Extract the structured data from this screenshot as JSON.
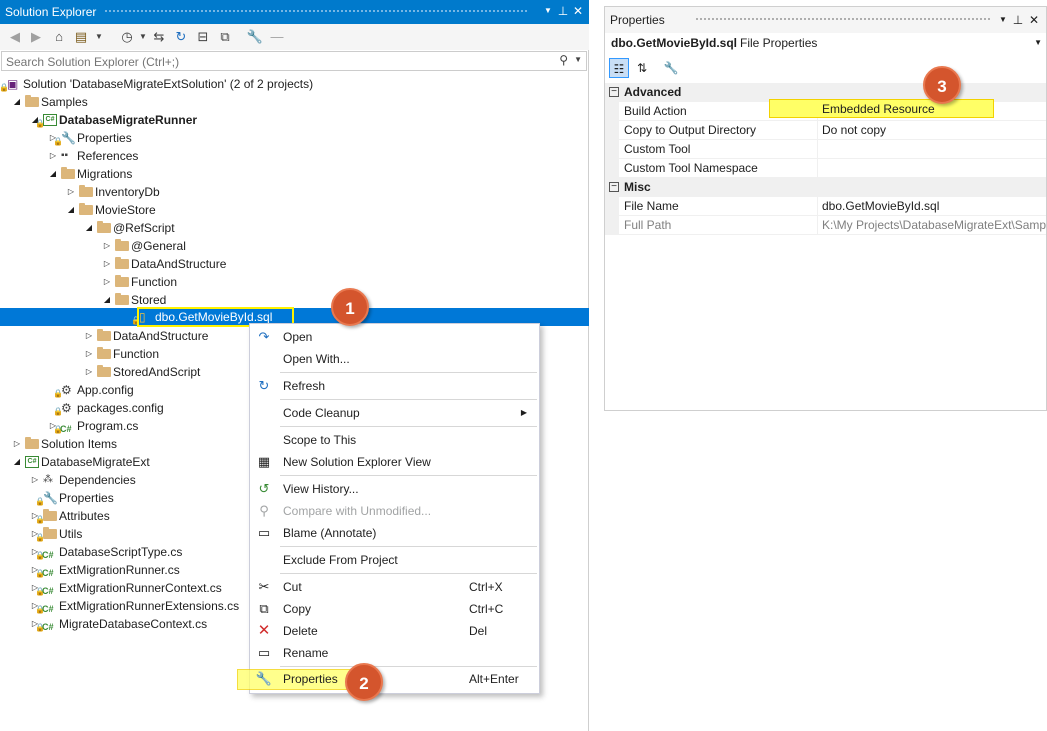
{
  "solution_explorer": {
    "title": "Solution Explorer",
    "search_placeholder": "Search Solution Explorer (Ctrl+;)",
    "tree": [
      {
        "label": "Solution 'DatabaseMigrateExtSolution' (2 of 2 projects)",
        "icon": "solution-icon"
      },
      {
        "label": "Samples",
        "icon": "folder-icon"
      },
      {
        "label": "DatabaseMigrateRunner",
        "icon": "csharp-project-icon"
      },
      {
        "label": "Properties",
        "icon": "wrench-icon"
      },
      {
        "label": "References",
        "icon": "references-icon"
      },
      {
        "label": "Migrations",
        "icon": "folder-icon"
      },
      {
        "label": "InventoryDb",
        "icon": "folder-icon"
      },
      {
        "label": "MovieStore",
        "icon": "folder-icon"
      },
      {
        "label": "@RefScript",
        "icon": "folder-icon"
      },
      {
        "label": "@General",
        "icon": "folder-icon"
      },
      {
        "label": "DataAndStructure",
        "icon": "folder-icon"
      },
      {
        "label": "Function",
        "icon": "folder-icon"
      },
      {
        "label": "Stored",
        "icon": "folder-icon"
      },
      {
        "label": "dbo.GetMovieById.sql",
        "icon": "sql-file-icon"
      },
      {
        "label": "DataAndStructure",
        "icon": "folder-icon"
      },
      {
        "label": "Function",
        "icon": "folder-icon"
      },
      {
        "label": "StoredAndScript",
        "icon": "folder-icon"
      },
      {
        "label": "App.config",
        "icon": "config-icon"
      },
      {
        "label": "packages.config",
        "icon": "config-icon"
      },
      {
        "label": "Program.cs",
        "icon": "csharp-file-icon"
      },
      {
        "label": "Solution Items",
        "icon": "folder-icon"
      },
      {
        "label": "DatabaseMigrateExt",
        "icon": "csharp-project-icon"
      },
      {
        "label": "Dependencies",
        "icon": "dependencies-icon"
      },
      {
        "label": "Properties",
        "icon": "wrench-icon"
      },
      {
        "label": "Attributes",
        "icon": "folder-icon"
      },
      {
        "label": "Utils",
        "icon": "folder-icon"
      },
      {
        "label": "DatabaseScriptType.cs",
        "icon": "csharp-file-icon"
      },
      {
        "label": "ExtMigrationRunner.cs",
        "icon": "csharp-file-icon"
      },
      {
        "label": "ExtMigrationRunnerContext.cs",
        "icon": "csharp-file-icon"
      },
      {
        "label": "ExtMigrationRunnerExtensions.cs",
        "icon": "csharp-file-icon"
      },
      {
        "label": "MigrateDatabaseContext.cs",
        "icon": "csharp-file-icon"
      }
    ]
  },
  "context_menu": {
    "items": [
      {
        "label": "Open",
        "shortcut": "",
        "icon": "open-icon"
      },
      {
        "label": "Open With...",
        "shortcut": "",
        "icon": ""
      },
      {
        "label": "Refresh",
        "shortcut": "",
        "icon": "refresh-icon"
      },
      {
        "label": "Code Cleanup",
        "shortcut": "",
        "icon": ""
      },
      {
        "label": "Scope to This",
        "shortcut": "",
        "icon": ""
      },
      {
        "label": "New Solution Explorer View",
        "shortcut": "",
        "icon": "new-view-icon"
      },
      {
        "label": "View History...",
        "shortcut": "",
        "icon": "history-icon"
      },
      {
        "label": "Compare with Unmodified...",
        "shortcut": "",
        "icon": "compare-icon"
      },
      {
        "label": "Blame (Annotate)",
        "shortcut": "",
        "icon": "blame-icon"
      },
      {
        "label": "Exclude From Project",
        "shortcut": "",
        "icon": ""
      },
      {
        "label": "Cut",
        "shortcut": "Ctrl+X",
        "icon": "cut-icon"
      },
      {
        "label": "Copy",
        "shortcut": "Ctrl+C",
        "icon": "copy-icon"
      },
      {
        "label": "Delete",
        "shortcut": "Del",
        "icon": "delete-icon"
      },
      {
        "label": "Rename",
        "shortcut": "",
        "icon": "rename-icon"
      },
      {
        "label": "Properties",
        "shortcut": "Alt+Enter",
        "icon": "wrench-icon"
      }
    ]
  },
  "properties": {
    "title": "Properties",
    "object_name": "dbo.GetMovieById.sql",
    "object_kind": "File Properties",
    "categories": [
      {
        "name": "Advanced",
        "rows": [
          {
            "name": "Build Action",
            "value": "Embedded Resource"
          },
          {
            "name": "Copy to Output Directory",
            "value": "Do not copy"
          },
          {
            "name": "Custom Tool",
            "value": ""
          },
          {
            "name": "Custom Tool Namespace",
            "value": ""
          }
        ]
      },
      {
        "name": "Misc",
        "rows": [
          {
            "name": "File Name",
            "value": "dbo.GetMovieById.sql"
          },
          {
            "name": "Full Path",
            "value": "K:\\My Projects\\DatabaseMigrateExt\\Samp"
          }
        ]
      }
    ]
  },
  "callouts": [
    "1",
    "2",
    "3"
  ],
  "colors": {
    "accent": "#007acc",
    "selection": "#0078d7",
    "highlight": "#ffff66",
    "badge": "#d4552d"
  }
}
